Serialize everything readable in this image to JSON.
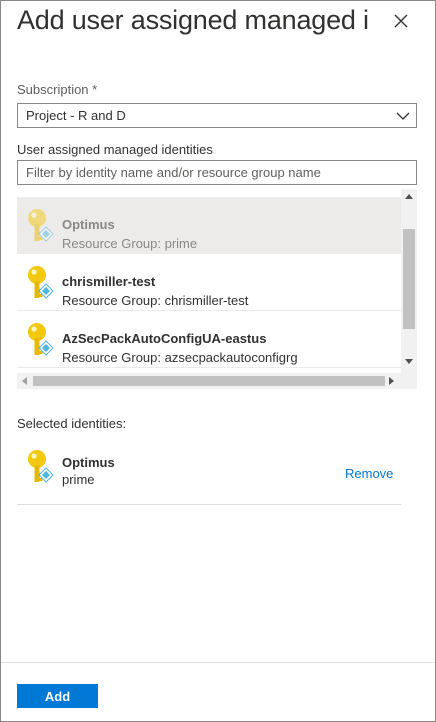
{
  "header": {
    "title": "Add user assigned managed i...",
    "close_icon": "close-icon"
  },
  "subscription": {
    "label": "Subscription",
    "required_marker": "*",
    "selected_value": "Project  - R and D"
  },
  "identities": {
    "label": "User assigned managed identities",
    "filter_placeholder": "Filter by identity name and/or resource group name",
    "items": [
      {
        "name": "Optimus",
        "resource_group": "Resource Group: prime",
        "disabled": true
      },
      {
        "name": "chrismiller-test",
        "resource_group": "Resource Group: chrismiller-test",
        "disabled": false
      },
      {
        "name": "AzSecPackAutoConfigUA-eastus",
        "resource_group": "Resource Group: azsecpackautoconfigrg",
        "disabled": false
      }
    ]
  },
  "selected": {
    "label": "Selected identities:",
    "items": [
      {
        "name": "Optimus",
        "resource_group": "prime",
        "remove_label": "Remove"
      }
    ]
  },
  "footer": {
    "add_label": "Add"
  },
  "colors": {
    "accent": "#0078d4",
    "key_yellow": "#f2c811",
    "key_badge": "#50b6e8"
  }
}
